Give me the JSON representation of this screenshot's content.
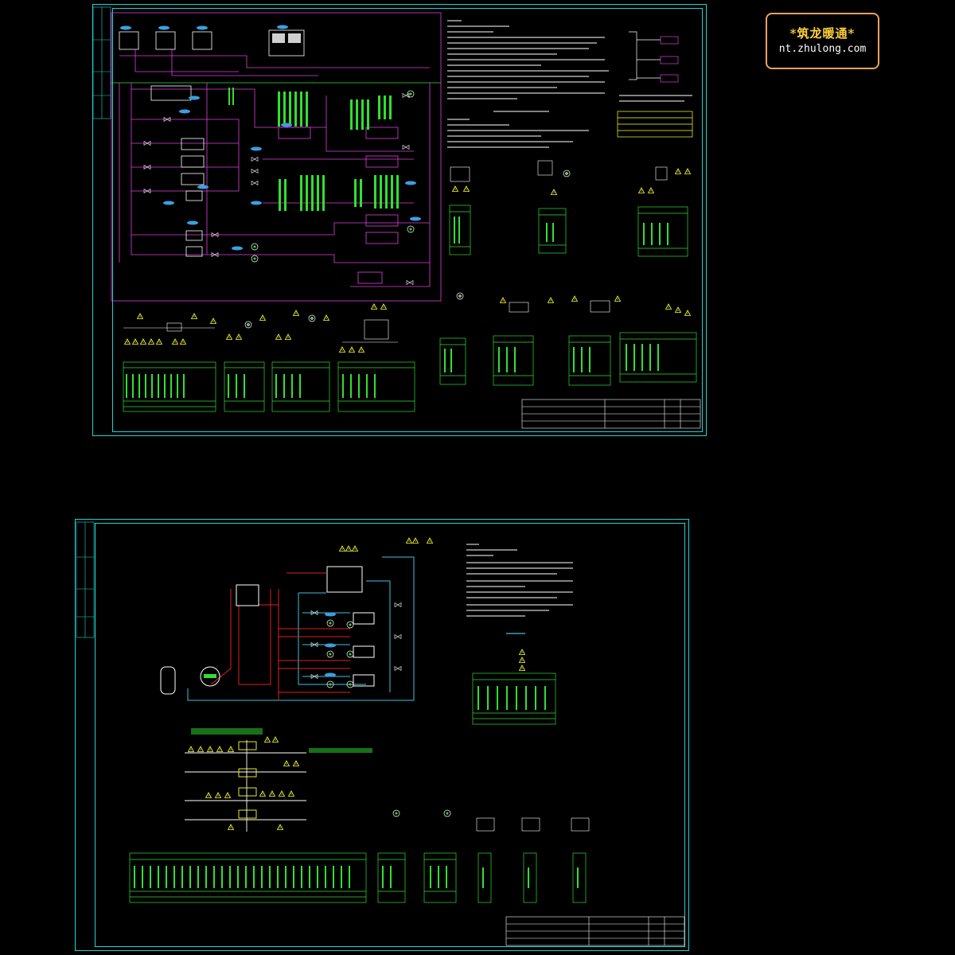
{
  "logo": {
    "line1": "*筑龙暖通*",
    "line2": "nt.zhulong.com"
  },
  "colors": {
    "background": "#000000",
    "frame": "#22d3d3",
    "pipe_magenta": "#e040e0",
    "pipe_red": "#e02020",
    "pipe_cyan": "#40c0e0",
    "device_yellow": "#ffff30",
    "table_green": "#30e030",
    "logo_border": "#f0a060",
    "logo_text": "#ffd23a"
  },
  "icons": {
    "valve": "valve-icon",
    "sensor": "sensor-triangle-icon",
    "pump": "pump-icon",
    "tank": "tank-icon"
  }
}
